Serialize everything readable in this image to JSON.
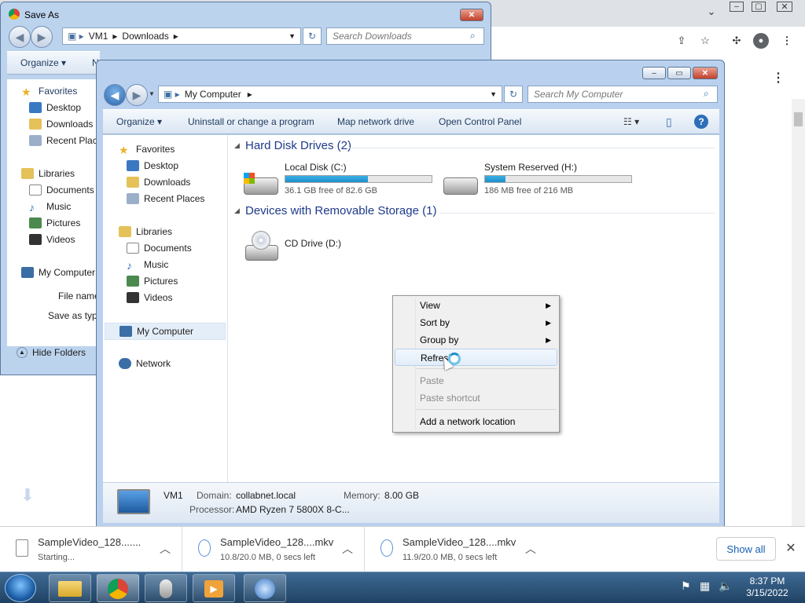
{
  "colors": {
    "accent": "#26a0da",
    "link": "#1a5fb4",
    "taskbar": "#2a5078"
  },
  "chrome": {
    "window_controls": [
      "chevron-down-icon",
      "minimize-icon",
      "restore-icon",
      "close-icon"
    ],
    "toolbar_icons": [
      "share-icon",
      "star-icon",
      "extensions-icon",
      "profile-icon",
      "menu-icon"
    ]
  },
  "save_as": {
    "title": "Save As",
    "breadcrumb": [
      "VM1",
      "Downloads"
    ],
    "search_placeholder": "Search Downloads",
    "organize": "Organize",
    "new_folder_partial": "N",
    "nav": {
      "favorites": "Favorites",
      "favorites_items": [
        "Desktop",
        "Downloads",
        "Recent Places"
      ],
      "libraries": "Libraries",
      "libraries_items": [
        "Documents",
        "Music",
        "Pictures",
        "Videos"
      ],
      "my_computer": "My Computer"
    },
    "file_name_label": "File name",
    "save_as_type_label": "Save as type",
    "hide_folders": "Hide Folders"
  },
  "explorer": {
    "breadcrumb": [
      "My Computer"
    ],
    "search_placeholder": "Search My Computer",
    "toolbar": {
      "organize": "Organize",
      "uninstall": "Uninstall or change a program",
      "map_drive": "Map network drive",
      "control_panel": "Open Control Panel"
    },
    "nav": {
      "favorites": "Favorites",
      "favorites_items": [
        "Desktop",
        "Downloads",
        "Recent Places"
      ],
      "libraries": "Libraries",
      "libraries_items": [
        "Documents",
        "Music",
        "Pictures",
        "Videos"
      ],
      "my_computer": "My Computer",
      "network": "Network"
    },
    "hdd_group": "Hard Disk Drives (2)",
    "drives": [
      {
        "name": "Local Disk (C:)",
        "free": "36.1 GB free of 82.6 GB",
        "used_fraction": 0.563
      },
      {
        "name": "System Reserved (H:)",
        "free": "186 MB free of 216 MB",
        "used_fraction": 0.139
      }
    ],
    "removable_group": "Devices with Removable Storage (1)",
    "cd_drive": "CD Drive (D:)",
    "details": {
      "name": "VM1",
      "domain_label": "Domain:",
      "domain": "collabnet.local",
      "memory_label": "Memory:",
      "memory": "8.00 GB",
      "processor_label": "Processor:",
      "processor": "AMD Ryzen 7 5800X 8-C..."
    }
  },
  "context_menu": {
    "view": "View",
    "sort_by": "Sort by",
    "group_by": "Group by",
    "refresh": "Refresh",
    "paste": "Paste",
    "paste_shortcut": "Paste shortcut",
    "add_network_location": "Add a network location"
  },
  "downloads": [
    {
      "name": "SampleVideo_128.......",
      "status": "Starting..."
    },
    {
      "name": "SampleVideo_128....mkv",
      "status": "10.8/20.0 MB, 0 secs left"
    },
    {
      "name": "SampleVideo_128....mkv",
      "status": "11.9/20.0 MB, 0 secs left"
    }
  ],
  "show_all": "Show all",
  "taskbar": {
    "time": "8:37 PM",
    "date": "3/15/2022",
    "apps": [
      "explorer-icon",
      "chrome-icon",
      "mouse-icon",
      "media-player-icon",
      "settings-icon"
    ]
  }
}
